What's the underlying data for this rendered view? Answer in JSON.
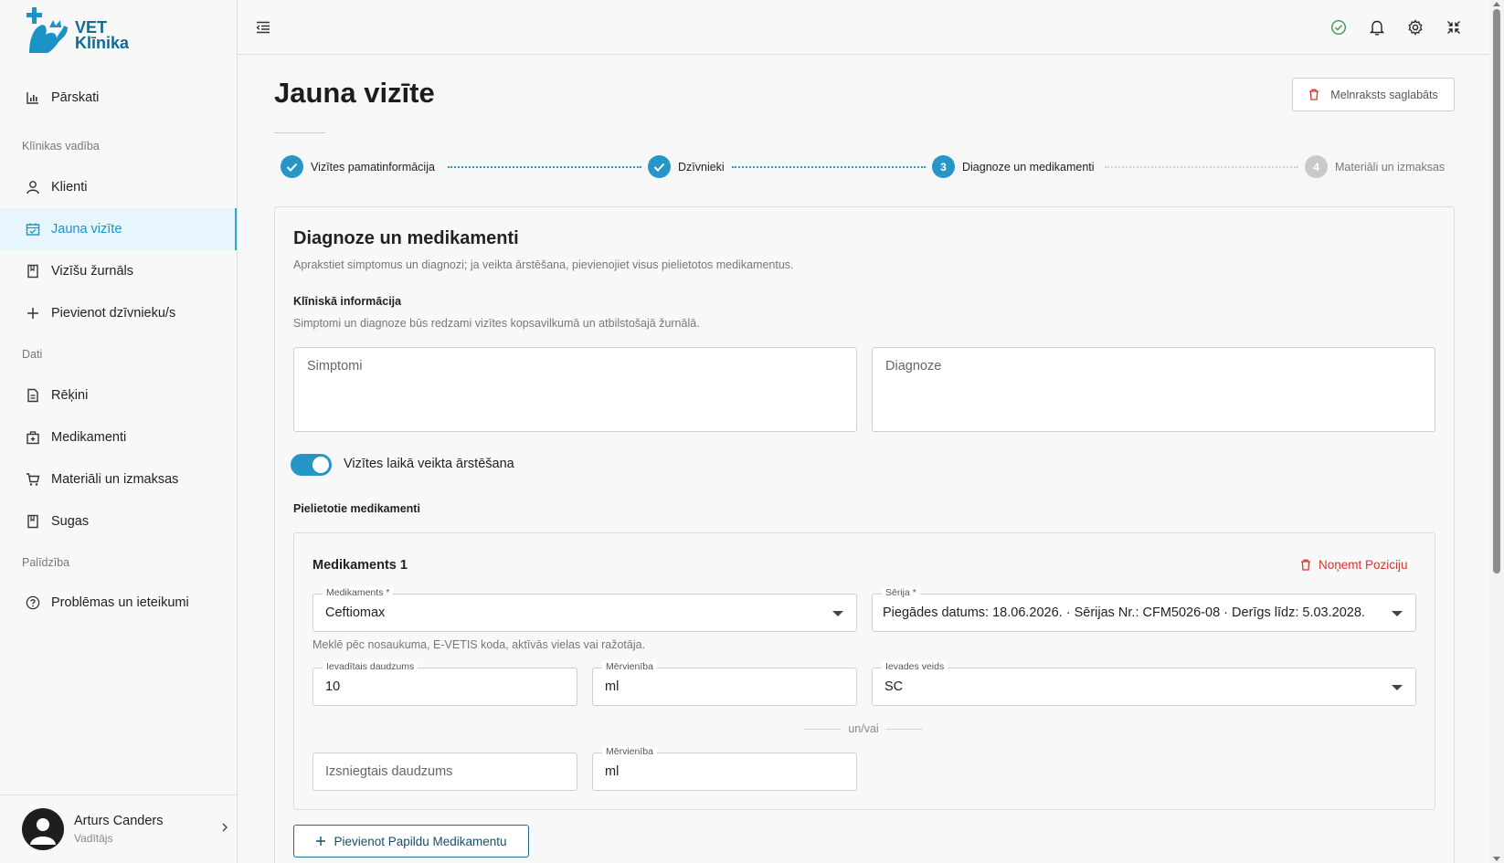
{
  "app": {
    "logo_line1": "VET",
    "logo_line2": "Klīnika"
  },
  "sidebar": {
    "items": [
      {
        "label": "Pārskati",
        "icon": "bar-chart-icon"
      },
      {
        "section": "Klīnikas vadība"
      },
      {
        "label": "Klienti",
        "icon": "user-icon"
      },
      {
        "label": "Jauna vizīte",
        "icon": "calendar-check-icon",
        "active": true
      },
      {
        "label": "Vizīšu žurnāls",
        "icon": "bookmark-icon"
      },
      {
        "label": "Pievienot dzīvnieku/s",
        "icon": "plus-icon"
      },
      {
        "section": "Dati"
      },
      {
        "label": "Rēķini",
        "icon": "invoice-icon"
      },
      {
        "label": "Medikamenti",
        "icon": "medical-bag-icon"
      },
      {
        "label": "Materiāli un izmaksas",
        "icon": "cart-icon"
      },
      {
        "label": "Sugas",
        "icon": "bookmark-icon"
      },
      {
        "section": "Palīdzība"
      },
      {
        "label": "Problēmas un ieteikumi",
        "icon": "help-circle-icon"
      }
    ],
    "sections": {
      "clinic": "Klīnikas vadība",
      "data": "Dati",
      "help": "Palīdzība"
    },
    "labels": {
      "reports": "Pārskati",
      "clients": "Klienti",
      "new_visit": "Jauna vizīte",
      "visit_log": "Vizīšu žurnāls",
      "add_animal": "Pievienot dzīvnieku/s",
      "invoices": "Rēķini",
      "medications": "Medikamenti",
      "materials": "Materiāli un izmaksas",
      "species": "Sugas",
      "issues": "Problēmas un ieteikumi"
    }
  },
  "user": {
    "name": "Arturs Canders",
    "role": "Vadītājs"
  },
  "page": {
    "title": "Jauna vizīte",
    "draft_button": "Melnraksts saglabāts"
  },
  "stepper": {
    "steps": [
      {
        "label": "Vizītes pamatinformācija",
        "state": "done"
      },
      {
        "label": "Dzīvnieki",
        "state": "done"
      },
      {
        "label": "Diagnoze un medikamenti",
        "state": "current",
        "number": "3"
      },
      {
        "label": "Materiāli un izmaksas",
        "state": "todo",
        "number": "4"
      }
    ]
  },
  "form": {
    "title": "Diagnoze un medikamenti",
    "subtitle": "Aprakstiet simptomus un diagnozi; ja veikta ārstēšana, pievienojiet visus pielietotos medikamentus.",
    "clinical_title": "Klīniskā informācija",
    "clinical_sub": "Simptomi un diagnoze būs redzami vizītes kopsavilkumā un atbilstošajā žurnālā.",
    "symptoms_placeholder": "Simptomi",
    "diagnosis_placeholder": "Diagnoze",
    "treatment_toggle_label": "Vizītes laikā veikta ārstēšana",
    "treatment_toggle_on": true,
    "meds_title": "Pielietotie medikamenti",
    "add_med_button": "Pievienot Papildu Medikamentu"
  },
  "medication": {
    "title": "Medikaments 1",
    "remove_label": "Noņemt Poziciju",
    "med_label": "Medikaments *",
    "med_value": "Ceftiomax",
    "series_label": "Sērija *",
    "series_value": "Piegādes datums: 18.06.2026. · Sērijas Nr.: CFM5026-08 · Derīgs līdz: 5.03.2028.",
    "helper": "Meklē pēc nosaukuma, E-VETIS koda, aktīvās vielas vai ražotāja.",
    "admin_qty_label": "Ievadītais daudzums",
    "admin_qty_value": "10",
    "unit_label": "Mērvienība",
    "unit_value": "ml",
    "route_label": "Ievades veids",
    "route_value": "SC",
    "or_label": "un/vai",
    "dispensed_placeholder": "Izsniegtais daudzums",
    "unit2_label": "Mērvienība",
    "unit2_value": "ml"
  },
  "colors": {
    "accent": "#2596c7",
    "active_bg": "#e6f6fc",
    "danger": "#d0362f",
    "brand": "#0f6b93"
  }
}
